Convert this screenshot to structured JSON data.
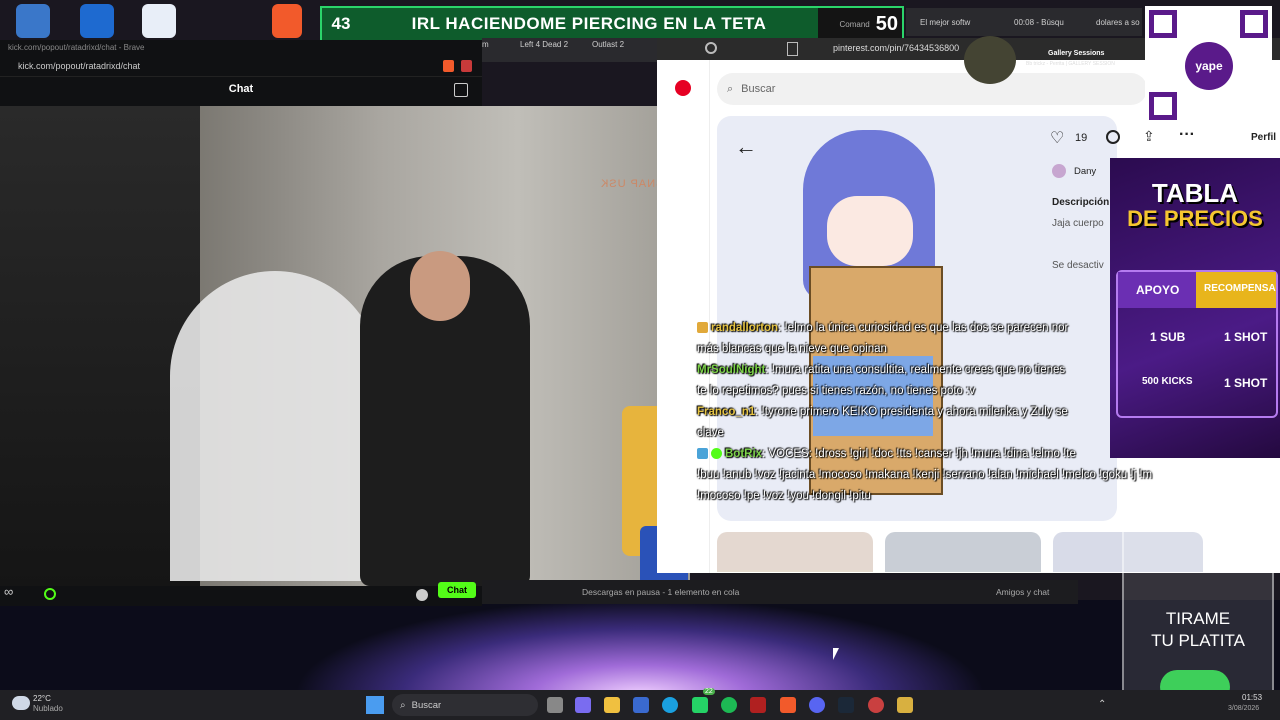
{
  "banner": {
    "count": "43",
    "title": "IRL HACIENDOME PIERCING EN LA TETA",
    "cmd_label": "Comand",
    "cmd_value": "50"
  },
  "tabs": {
    "t1": "El mejor softw",
    "t2": "00:08 - Búsqu",
    "t3": "dolares a so",
    "t4": "Left 4 Dead 2",
    "t5": "Outlast 2",
    "t6": "m"
  },
  "kick": {
    "window_title": "kick.com/popout/ratadrixd/chat - Brave",
    "url": "kick.com/popout/ratadrixd/chat",
    "chat_header": "Chat",
    "chat_button": "Chat",
    "bottom_count": "∞"
  },
  "video": {
    "watermark": "SNAP USK"
  },
  "pinterest": {
    "url": "pinterest.com/pin/76434536800",
    "search_placeholder": "Buscar",
    "likes": "19",
    "user": "Dany",
    "section": "Descripción",
    "desc": "Jaja cuerpo",
    "hidden_note": "Se desactiv",
    "profile": "Perfil"
  },
  "gallery": {
    "title": "Gallery Sessions",
    "sub": "Bb trickz - Perrita | GALLERY SESSION"
  },
  "chat": [
    {
      "user": "randallorton",
      "text": ": !elmo la única curiosidad es que las dos se parecen nor",
      "cont": "más blancas que la nieve que opinan",
      "gold": true
    },
    {
      "user": "MrSoulNight",
      "text": ": !mura ratita una consultita, realmente crees que no tienes",
      "cont": "te lo repetimos? pues si tienes razón, no tienes poto :v",
      "gold": false
    },
    {
      "user": "Franco_n1",
      "text": ": !tyrone primero KEIKO presidenta y ahora milenka y Zuly se",
      "cont": "clave",
      "gold": true
    },
    {
      "user": "BotRix",
      "text": ": VOCES: !dross !girl !doc !tts !canser !jh !mura !dina !elmo !te",
      "cont": "!buu !anub !voz !jacinta !mocoso !makana !kenji !serrano !alan !michael !melco !goku !j !m",
      "cont2": "!mocoso !pe !voz !you !dongil !pitu",
      "gold": false
    }
  ],
  "price_table": {
    "title": "TABLA",
    "subtitle": "DE PRECIOS",
    "col1": "APOYO",
    "col2": "RECOMPENSA",
    "r1a": "1 SUB",
    "r1b": "1 SHOT",
    "r2a": "500 KICKS",
    "r2b": "1 SHOT"
  },
  "qr_label": "yape",
  "jar": {
    "line1": "TIRAME",
    "line2": "TU PLATITA"
  },
  "downloads": {
    "status": "Descargas en pausa - 1 elemento en cola",
    "friends": "Amigos y chat"
  },
  "taskbar": {
    "temp": "22°C",
    "weather": "Nublado",
    "search": "Buscar",
    "time": "01:53",
    "date": "3/08/2026",
    "badge": "22"
  },
  "colors": {
    "kick_green": "#53fc18",
    "pinterest_red": "#e60023",
    "banner_green": "#0e5c2c"
  }
}
